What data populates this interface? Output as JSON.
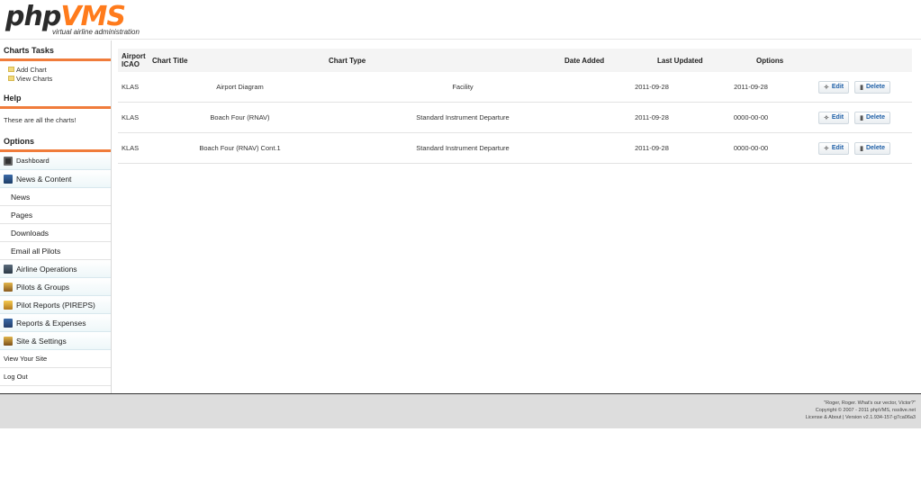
{
  "logo": {
    "php": "php",
    "vms": "VMS",
    "subtitle": "virtual airline administration"
  },
  "sidebar": {
    "tasks_heading": "Charts Tasks",
    "tasks": [
      {
        "label": "Add Chart"
      },
      {
        "label": "View Charts"
      }
    ],
    "help_heading": "Help",
    "help_text": "These are all the charts!",
    "options_heading": "Options",
    "menu": {
      "dashboard": "Dashboard",
      "news_content": "News & Content",
      "news": "News",
      "pages": "Pages",
      "downloads": "Downloads",
      "email_pilots": "Email all Pilots",
      "airline_ops": "Airline Operations",
      "pilots_groups": "Pilots & Groups",
      "pireps": "Pilot Reports (PIREPS)",
      "reports_expenses": "Reports & Expenses",
      "site_settings": "Site & Settings",
      "view_site": "View Your Site",
      "logout": "Log Out"
    }
  },
  "table": {
    "headers": {
      "icao_line1": "Airport",
      "icao_line2": "ICAO",
      "title": "Chart Title",
      "type": "Chart Type",
      "added": "Date Added",
      "updated": "Last Updated",
      "options": "Options"
    },
    "rows": [
      {
        "icao": "KLAS",
        "title": "Airport Diagram",
        "type": "Facility",
        "added": "2011-09-28",
        "updated": "2011-09-28"
      },
      {
        "icao": "KLAS",
        "title": "Boach Four (RNAV)",
        "type": "Standard Instrument Departure",
        "added": "2011-09-28",
        "updated": "0000-00-00"
      },
      {
        "icao": "KLAS",
        "title": "Boach Four (RNAV) Cont.1",
        "type": "Standard Instrument Departure",
        "added": "2011-09-28",
        "updated": "0000-00-00"
      }
    ],
    "edit_label": "Edit",
    "delete_label": "Delete"
  },
  "footer": {
    "quote": "\"Roger, Roger. What's our vector, Victor?\"",
    "copyright": "Copyright © 2007 - 2011 phpVMS, nsslive.net",
    "version": "License & About | Version v2.1.934-157-g7ca06a3"
  }
}
